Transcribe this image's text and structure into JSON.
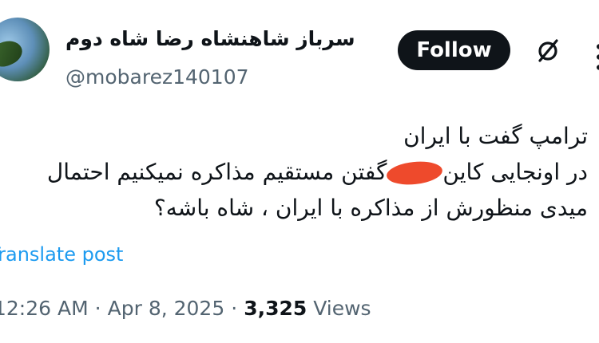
{
  "author": {
    "display_name": "سرباز شاهنشاه رضا شاه دوم",
    "handle": "@mobarez140107"
  },
  "actions": {
    "follow_label": "Follow",
    "grok_icon": "slashed-circle-icon",
    "more_icon": "more-dots-icon"
  },
  "tweet": {
    "line1": "ترامپ گفت با ایران",
    "line2_part1": "در اونجایی کاین",
    "line2_part2": "گفتن مستقیم مذاکره نمیکنیم احتمال",
    "line3": "میدی منظورش از مذاکره با ایران ، شاه باشه؟",
    "translate_label": "Translate post"
  },
  "meta": {
    "time": "12:26 AM",
    "date": "Apr 8, 2025",
    "views_count": "3,325",
    "views_label": "Views",
    "separator": "·"
  },
  "colors": {
    "follow_bg": "#0f1419",
    "link": "#1d9bf0",
    "secondary_text": "#536471",
    "redaction": "#ee4a2c"
  }
}
